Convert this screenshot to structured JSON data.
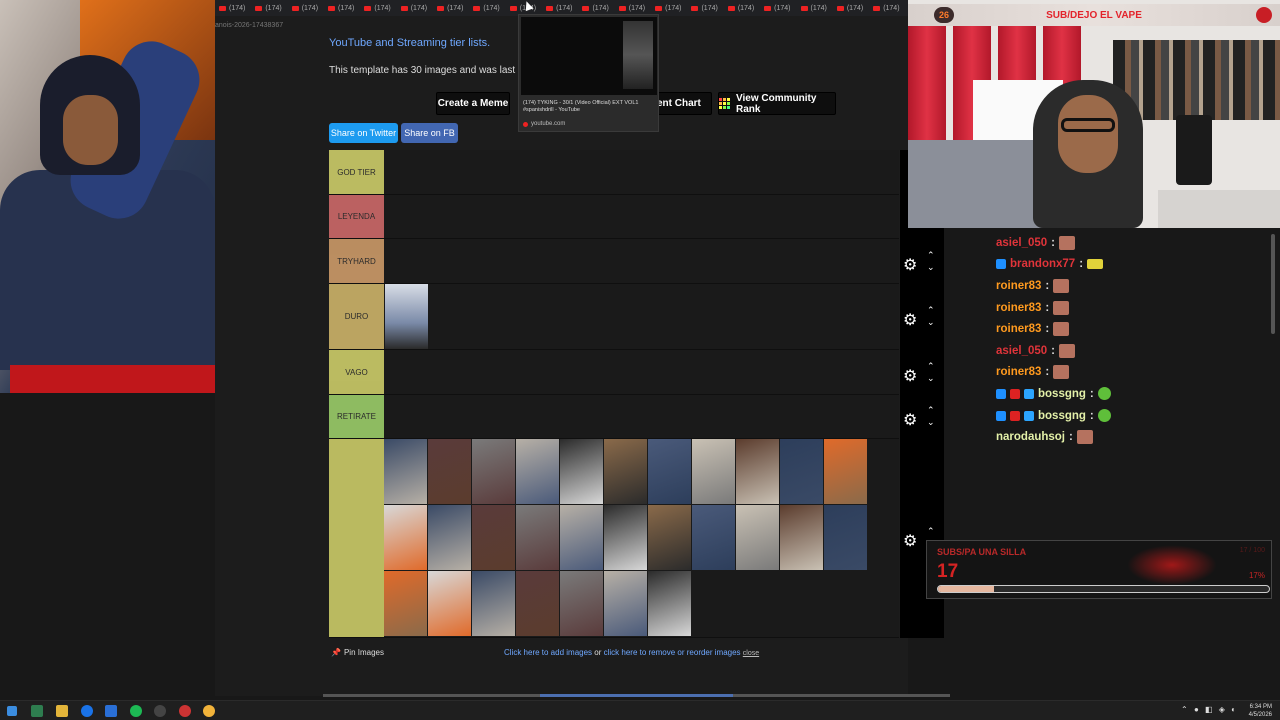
{
  "browser": {
    "tab_label": "(174)",
    "tab_count": 46,
    "url_fragment": "anois-2026-17438367"
  },
  "page": {
    "intro_link": "YouTube and Streaming tier lists.",
    "intro_text": "This template has 30 images and was last mo",
    "buttons": {
      "create_meme": "Create a Meme",
      "comment_chart": "ment Chart",
      "view_rank": "View Community Rank"
    },
    "share": {
      "twitter": "Share on Twitter",
      "fb": "Share on FB"
    }
  },
  "tooltip": {
    "title": "(174) TYKING - 30/1 (Video Official) EXT VOL1 #spanishdrill - YouTube",
    "domain": "youtube.com"
  },
  "tiers": [
    {
      "label": "GOD TIER",
      "color": "#ffff7f"
    },
    {
      "label": "LEYENDA",
      "color": "#ff7f7f"
    },
    {
      "label": "TRYHARD",
      "color": "#ffbf7f"
    },
    {
      "label": "DURO",
      "color": "#ffdf7f"
    },
    {
      "label": "VAGO",
      "color": "#ffff7f"
    },
    {
      "label": "RETIRATE",
      "color": "#bfff7f"
    },
    {
      "label": "",
      "color": "#ffff7f"
    }
  ],
  "pool_image_count": 29,
  "footer": {
    "pin_images": "Pin Images",
    "add_images": "Click here to add images",
    "or": " or ",
    "remove_images": "click here to remove or reorder images",
    "close": "close"
  },
  "stream_overlay": {
    "header_count": "26",
    "header_title": "SUB/DEJO EL VAPE"
  },
  "chat": [
    {
      "user": "asiel_050",
      "color": "#e0343a",
      "badges": [],
      "emote": "face"
    },
    {
      "user": "brandonx77",
      "color": "#e0343a",
      "badges": [
        "#1e90ff"
      ],
      "emote": "hat"
    },
    {
      "user": "roiner83",
      "color": "#ff9a1f",
      "badges": [],
      "emote": "face"
    },
    {
      "user": "roiner83",
      "color": "#ff9a1f",
      "badges": [],
      "emote": "face"
    },
    {
      "user": "roiner83",
      "color": "#ff9a1f",
      "badges": [],
      "emote": "face"
    },
    {
      "user": "asiel_050",
      "color": "#e0343a",
      "badges": [],
      "emote": "face"
    },
    {
      "user": "roiner83",
      "color": "#ff9a1f",
      "badges": [],
      "emote": "face"
    },
    {
      "user": "bossgng",
      "color": "#e3f0a8",
      "badges": [
        "#1e90ff",
        "#d22",
        "#2ca6ff"
      ],
      "emote": "green"
    },
    {
      "user": "bossgng",
      "color": "#e3f0a8",
      "badges": [
        "#1e90ff",
        "#d22",
        "#2ca6ff"
      ],
      "emote": "green"
    },
    {
      "user": "narodauhsoj",
      "color": "#e3f0a8",
      "badges": [],
      "emote": "face"
    }
  ],
  "goal": {
    "title": "SUBS/PA UNA SILLA",
    "current": "17",
    "target": "17 / 100",
    "percent": "17%",
    "progress": 0.17
  },
  "taskbar": {
    "time": "6:34 PM",
    "date": "4/5/2026"
  }
}
